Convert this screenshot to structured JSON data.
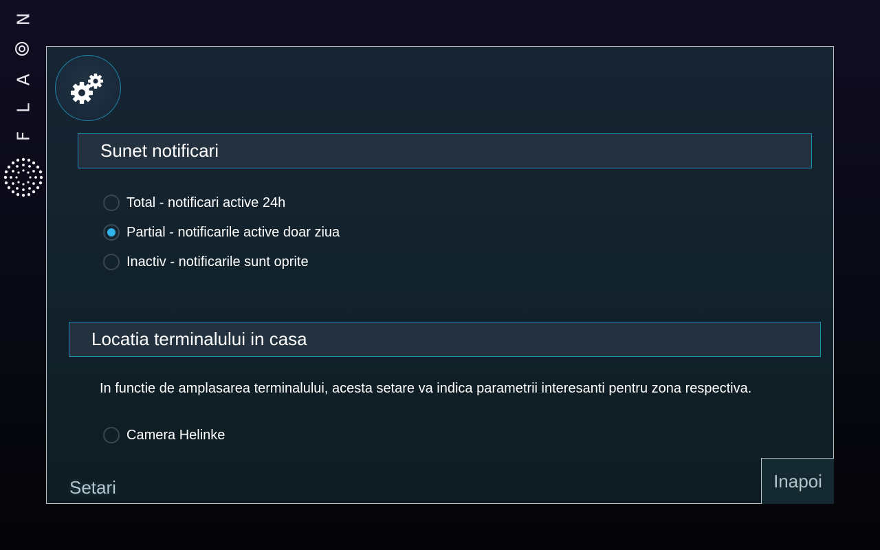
{
  "brand": {
    "letters": [
      "N",
      "A",
      "L",
      "F"
    ]
  },
  "panel": {
    "settings_icon": "gears-icon",
    "notifications": {
      "header": "Sunet notificari",
      "options": [
        {
          "label": "Total - notificari active 24h",
          "selected": false
        },
        {
          "label": "Partial - notificarile active doar ziua",
          "selected": true
        },
        {
          "label": "Inactiv - notificarile sunt oprite",
          "selected": false
        }
      ]
    },
    "location": {
      "header": "Locatia terminalului in casa",
      "description": "In functie de amplasarea terminalului, acesta setare va indica parametrii interesanti pentru zona respectiva.",
      "options": [
        {
          "label": "Camera Helinke",
          "selected": false
        }
      ]
    },
    "footer_title": "Setari",
    "back_label": "Inapoi"
  },
  "colors": {
    "accent": "#2fb3ea",
    "header_border": "#1a8fb7",
    "panel_border": "#b9c3cc",
    "muted_text": "#b5c3cc"
  }
}
